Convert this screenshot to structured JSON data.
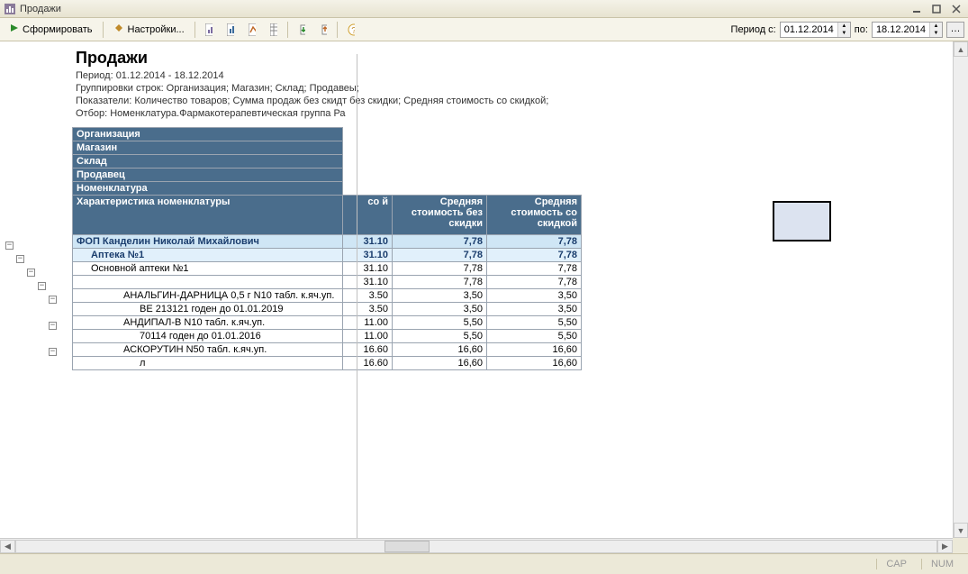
{
  "window": {
    "title": "Продажи"
  },
  "toolbar": {
    "run": "Сформировать",
    "settings": "Настройки...",
    "period_label_from": "Период с:",
    "period_label_to": "по:",
    "date_from": "01.12.2014",
    "date_to": "18.12.2014"
  },
  "report": {
    "title": "Продажи",
    "meta1": "Период: 01.12.2014 - 18.12.2014",
    "meta2": "Группировки строк: Организация; Магазин; Склад; Продавеы;",
    "meta3": "Показатели: Количество товаров; Сумма продаж без скидт без скидки; Средняя стоимость со скидкой;",
    "meta4": "Отбор: Номенклатура.Фармакотерапевтическая группа Ра"
  },
  "headers": {
    "org": "Организация",
    "shop": "Магазин",
    "stock": "Склад",
    "seller": "Продавец",
    "nomen": "Номенклатура",
    "charact": "Характеристика номенклатуры",
    "col_hidden": " со й",
    "col2": "Средняя стоимость без скидки",
    "col3": "Средняя стоимость со скидкой"
  },
  "rows": [
    {
      "lvl": 0,
      "name": "ФОП Канделин Николай Михайлович",
      "c1": "31.10",
      "c2": "7,78",
      "c3": "7,78"
    },
    {
      "lvl": 1,
      "name": "Аптека №1",
      "c1": "31.10",
      "c2": "7,78",
      "c3": "7,78"
    },
    {
      "lvl": 2,
      "name": "Основной аптеки №1",
      "indent": 2,
      "c1": "31.10",
      "c2": "7,78",
      "c3": "7,78"
    },
    {
      "lvl": 2,
      "name": "",
      "indent": 2,
      "c1": "31.10",
      "c2": "7,78",
      "c3": "7,78"
    },
    {
      "lvl": 2,
      "name": "АНАЛЬГИН-ДАРНИЦА 0,5 г N10 табл. к.яч.уп.",
      "indent": 3,
      "c1": "3.50",
      "c2": "3,50",
      "c3": "3,50"
    },
    {
      "lvl": 2,
      "name": "ВЕ 213121 годен до 01.01.2019",
      "indent": 4,
      "c1": "3.50",
      "c2": "3,50",
      "c3": "3,50"
    },
    {
      "lvl": 2,
      "name": "АНДИПАЛ-В N10 табл. к.яч.уп.",
      "indent": 3,
      "c1": "11.00",
      "c2": "5,50",
      "c3": "5,50"
    },
    {
      "lvl": 2,
      "name": "70114 годен до 01.01.2016",
      "indent": 4,
      "c1": "11.00",
      "c2": "5,50",
      "c3": "5,50"
    },
    {
      "lvl": 2,
      "name": "АСКОРУТИН N50 табл. к.яч.уп.",
      "indent": 3,
      "c1": "16.60",
      "c2": "16,60",
      "c3": "16,60"
    },
    {
      "lvl": 2,
      "name": "л",
      "indent": 4,
      "c1": "16.60",
      "c2": "16,60",
      "c3": "16,60"
    }
  ],
  "status": {
    "cap": "CAP",
    "num": "NUM"
  }
}
